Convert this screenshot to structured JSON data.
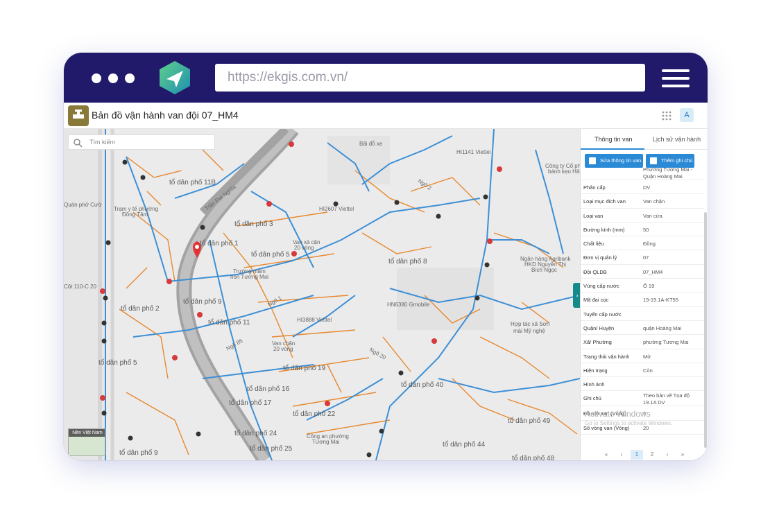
{
  "browser": {
    "url": "https://ekgis.com.vn/",
    "accent": "#211a6b"
  },
  "app": {
    "title": "Bản đồ vận hành van đội 07_HM4",
    "avatar": "A"
  },
  "map": {
    "search_placeholder": "Tìm kiếm",
    "basemap_label": "Nền Việt Nam",
    "labels": [
      "tổ dân phố 11B",
      "tổ dân phố 3",
      "tổ dân phố 1",
      "tổ dân phố 5",
      "tổ dân phố 8",
      "tổ dân phố 2",
      "tổ dân phố 9",
      "tổ dân phố 11",
      "tổ dân phố 5",
      "tổ dân phố 19",
      "tổ dân phố 16",
      "tổ dân phố 17",
      "tổ dân phố 40",
      "tổ dân phố 22",
      "tổ dân phố 24",
      "tổ dân phố 25",
      "tổ dân phố 44",
      "tổ dân phố 49",
      "tổ dân phố 48",
      "tổ dân phố 9",
      "Trần Đại Nghĩa",
      "Ngõ 2",
      "Ngõ 1",
      "Ngõ 85",
      "Ngõ 20",
      "Bãi đỗ xe",
      "Trạm y tế phường Đồng Tâm",
      "Quán phở Cườ",
      "Trường mầm non Tương Mai",
      "Hợp tác xã Sơn mài Mỹ nghệ",
      "Công ty Cổ phần bánh kẹo Hải Hà",
      "Ngân hàng Agribank HKD Nguyễn Thị Bích Ngọc",
      "Công an phường Tương Mai",
      "HI1141 Viettel",
      "HI2607 Viettel",
      "HI3888 Viettel",
      "HN6380 Gmobile",
      "Cột 110-C 20",
      "Van chặn 20 vòng",
      "Van xả cặn 20 vòng"
    ],
    "pipe_blue": "#3c8fd6",
    "pipe_orange": "#e8882e"
  },
  "panel": {
    "tabs": [
      "Thông tin van",
      "Lịch sử vận hành"
    ],
    "btn_edit": "Sửa thông tin van",
    "btn_note": "Thêm ghi chú",
    "top_value": "Phường Tương Mai - Quận Hoàng Mai",
    "rows": [
      {
        "k": "Phân cấp",
        "v": "DV"
      },
      {
        "k": "Loại mục đích van",
        "v": "Van chặn"
      },
      {
        "k": "Loại van",
        "v": "Van cửa"
      },
      {
        "k": "Đường kính (mm)",
        "v": "50"
      },
      {
        "k": "Chất liệu",
        "v": "Đồng"
      },
      {
        "k": "Đơn vị quản lý",
        "v": "07"
      },
      {
        "k": "Đội QLDB",
        "v": "07_HM4"
      },
      {
        "k": "Vùng cấp nước",
        "v": "Ô 19"
      },
      {
        "k": "Mã đai cọc",
        "v": "19-19.1A-KT55"
      },
      {
        "k": "Tuyến cấp nước",
        "v": ""
      },
      {
        "k": "Quận/ Huyện",
        "v": "quận Hoàng Mai"
      },
      {
        "k": "Xã/ Phường",
        "v": "phường Tương Mai"
      },
      {
        "k": "Trạng thái vận hành",
        "v": "Mở"
      },
      {
        "k": "Hiện trạng",
        "v": "Còn"
      },
      {
        "k": "Hình ảnh",
        "v": ""
      },
      {
        "k": "Ghi chú",
        "v": "Theo bản vẽ Tọa độ 19.1A DV"
      },
      {
        "k": "Độ mở van (Vòng)",
        "v": "5"
      },
      {
        "k": "Số vòng van (Vòng)",
        "v": "20"
      }
    ],
    "pager": [
      "«",
      "‹",
      "1",
      "2",
      "›",
      "»"
    ],
    "watermark": "Activate Windows",
    "watermark_sub": "Go to Settings to activate Windows."
  }
}
